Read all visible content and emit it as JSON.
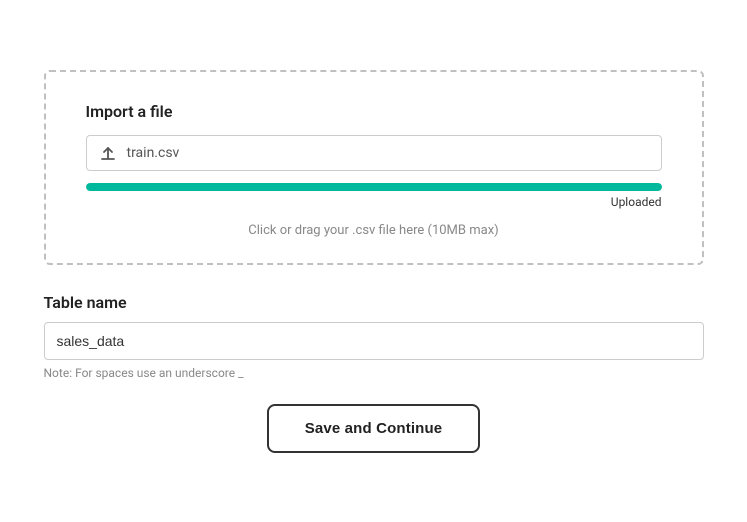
{
  "import_section": {
    "title": "Import a file",
    "file_name": "train.csv",
    "upload_icon": "↑",
    "progress_percent": 100,
    "progress_color": "#00b89c",
    "uploaded_label": "Uploaded",
    "drop_hint": "Click or drag your .csv file here (10MB max)"
  },
  "table_name_section": {
    "label": "Table name",
    "value": "sales_data",
    "placeholder": "sales_data",
    "note": "Note: For spaces use an underscore _"
  },
  "button": {
    "label": "Save and Continue"
  }
}
